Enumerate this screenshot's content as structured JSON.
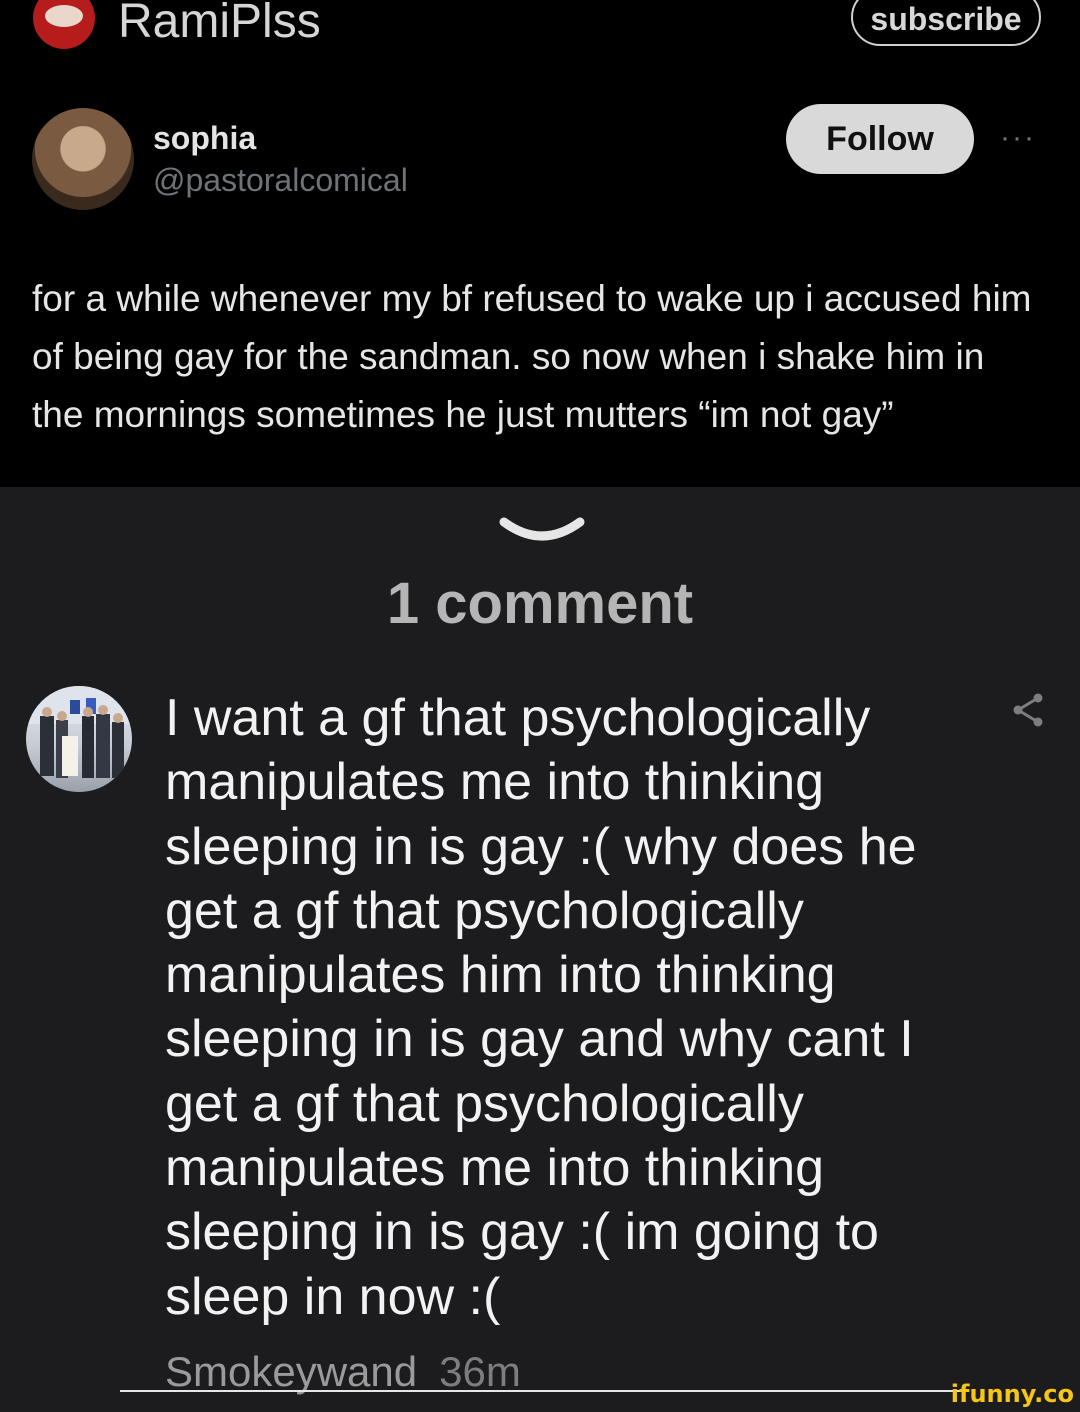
{
  "header": {
    "channel_name": "RamiPlss",
    "subscribe_label": "subscribe"
  },
  "tweet": {
    "name": "sophia",
    "handle": "@pastoralcomical",
    "follow_label": "Follow",
    "more_label": "···",
    "text": "for a while whenever my bf refused to wake up i accused him of being gay for the sandman. so now when i shake him in the mornings sometimes he just mutters “im not gay”"
  },
  "comments": {
    "count_label": "1 comment",
    "items": [
      {
        "text": "I want a gf that psychologically manipulates me into thinking sleeping in is gay :( why does he get a gf that psychologically manipulates him into thinking sleeping in is gay and why cant I get a gf that psychologically manipulates me into thinking sleeping in is gay :( im going to sleep in now :(",
        "author": "Smokeywand",
        "time": "36m"
      }
    ]
  },
  "watermark": "ifunny.co",
  "icons": {
    "header_avatar": "channel-avatar",
    "more": "more-dots-icon",
    "chevron": "chevron-down-icon",
    "share": "share-icon"
  },
  "colors": {
    "top_background": "#000000",
    "page_background": "#1c1c1e",
    "watermark": "#f5c518"
  }
}
